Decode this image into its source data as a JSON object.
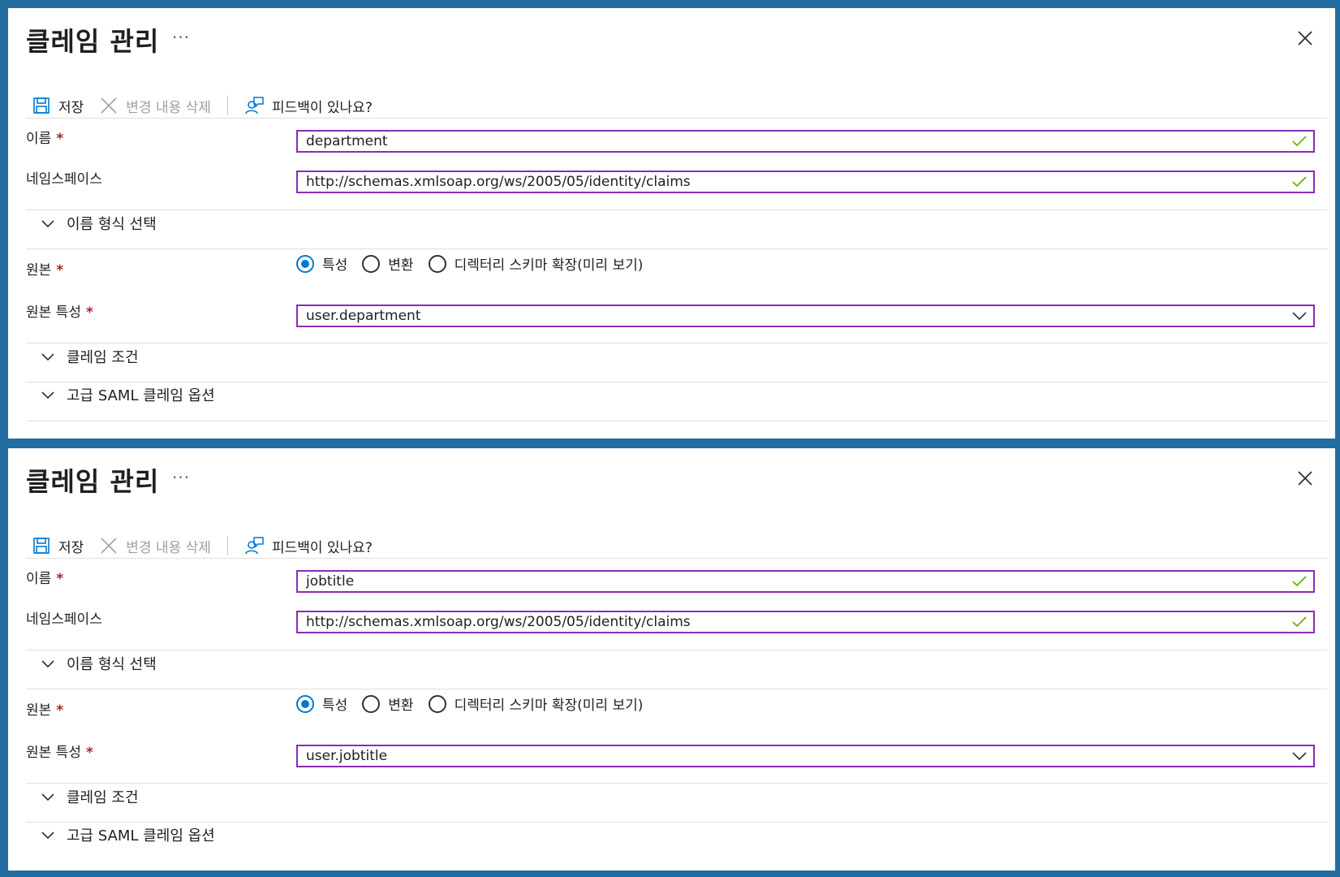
{
  "panels": [
    {
      "title": "클레임 관리",
      "more": "···",
      "toolbar": {
        "save": "저장",
        "discard": "변경 내용 삭제",
        "feedback": "피드백이 있나요?"
      },
      "name_label": "이름",
      "name_value": "department",
      "namespace_label": "네임스페이스",
      "namespace_value": "http://schemas.xmlsoap.org/ws/2005/05/identity/claims",
      "name_format_section": "이름 형식 선택",
      "source_label": "원본",
      "source_options": [
        "특성",
        "변환",
        "디렉터리 스키마 확장(미리 보기)"
      ],
      "source_selected": "특성",
      "source_attr_label": "원본 특성",
      "source_attr_value": "user.department",
      "claim_conditions_section": "클레임 조건",
      "advanced_section": "고급 SAML 클레임 옵션",
      "required_mark": "*"
    },
    {
      "title": "클레임 관리",
      "more": "···",
      "toolbar": {
        "save": "저장",
        "discard": "변경 내용 삭제",
        "feedback": "피드백이 있나요?"
      },
      "name_label": "이름",
      "name_value": "jobtitle",
      "namespace_label": "네임스페이스",
      "namespace_value": "http://schemas.xmlsoap.org/ws/2005/05/identity/claims",
      "name_format_section": "이름 형식 선택",
      "source_label": "원본",
      "source_options": [
        "특성",
        "변환",
        "디렉터리 스키마 확장(미리 보기)"
      ],
      "source_selected": "특성",
      "source_attr_label": "원본 특성",
      "source_attr_value": "user.jobtitle",
      "claim_conditions_section": "클레임 조건",
      "advanced_section": "고급 SAML 클레임 옵션",
      "required_mark": "*"
    }
  ],
  "colors": {
    "frame": "#236ca2",
    "focus_border": "#8a2bb5",
    "accent": "#0078d4",
    "check": "#6bb700",
    "required": "#a4262c"
  },
  "icons": {
    "save": "save-icon",
    "discard": "close-icon",
    "feedback": "feedback-icon",
    "valid": "checkmark-icon",
    "dropdown": "chevron-down-icon",
    "section": "chevron-down-icon",
    "close": "close-icon"
  }
}
